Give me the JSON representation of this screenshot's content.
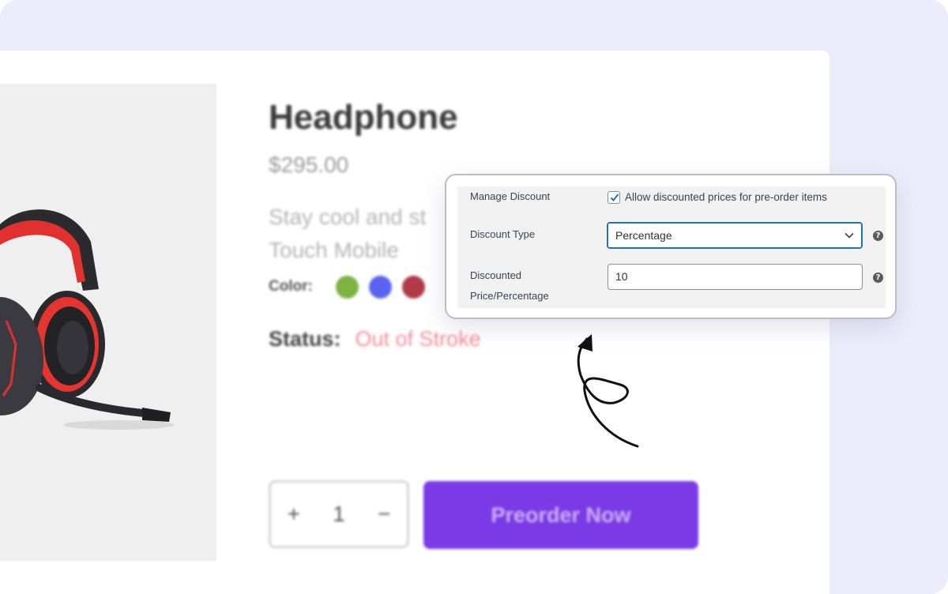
{
  "product": {
    "title": "Headphone",
    "price": "$295.00",
    "description": "Stay cool and st... Touch Mobile",
    "description_line1": "Stay cool and st",
    "description_line2": "Touch Mobile",
    "color_label": "Color:",
    "colors": [
      "#7cb342",
      "#5b63f0",
      "#b03a48"
    ],
    "status_label": "Status:",
    "status_value": "Out of Stroke"
  },
  "cart": {
    "plus_label": "+",
    "quantity": "1",
    "minus_label": "−",
    "preorder_label": "Preorder Now"
  },
  "discount_settings": {
    "manage_discount_label": "Manage Discount",
    "allow_checkbox_label": "Allow discounted prices for pre-order items",
    "allow_checked": true,
    "discount_type_label": "Discount Type",
    "discount_type_value": "Percentage",
    "discounted_label_line1": "Discounted",
    "discounted_label_line2": "Price/Percentage",
    "discounted_value": "10",
    "help_glyph": "?"
  },
  "colors": {
    "accent": "#2271b1",
    "preorder_bg": "#7a3ae6",
    "page_bg": "#ecedfb"
  }
}
